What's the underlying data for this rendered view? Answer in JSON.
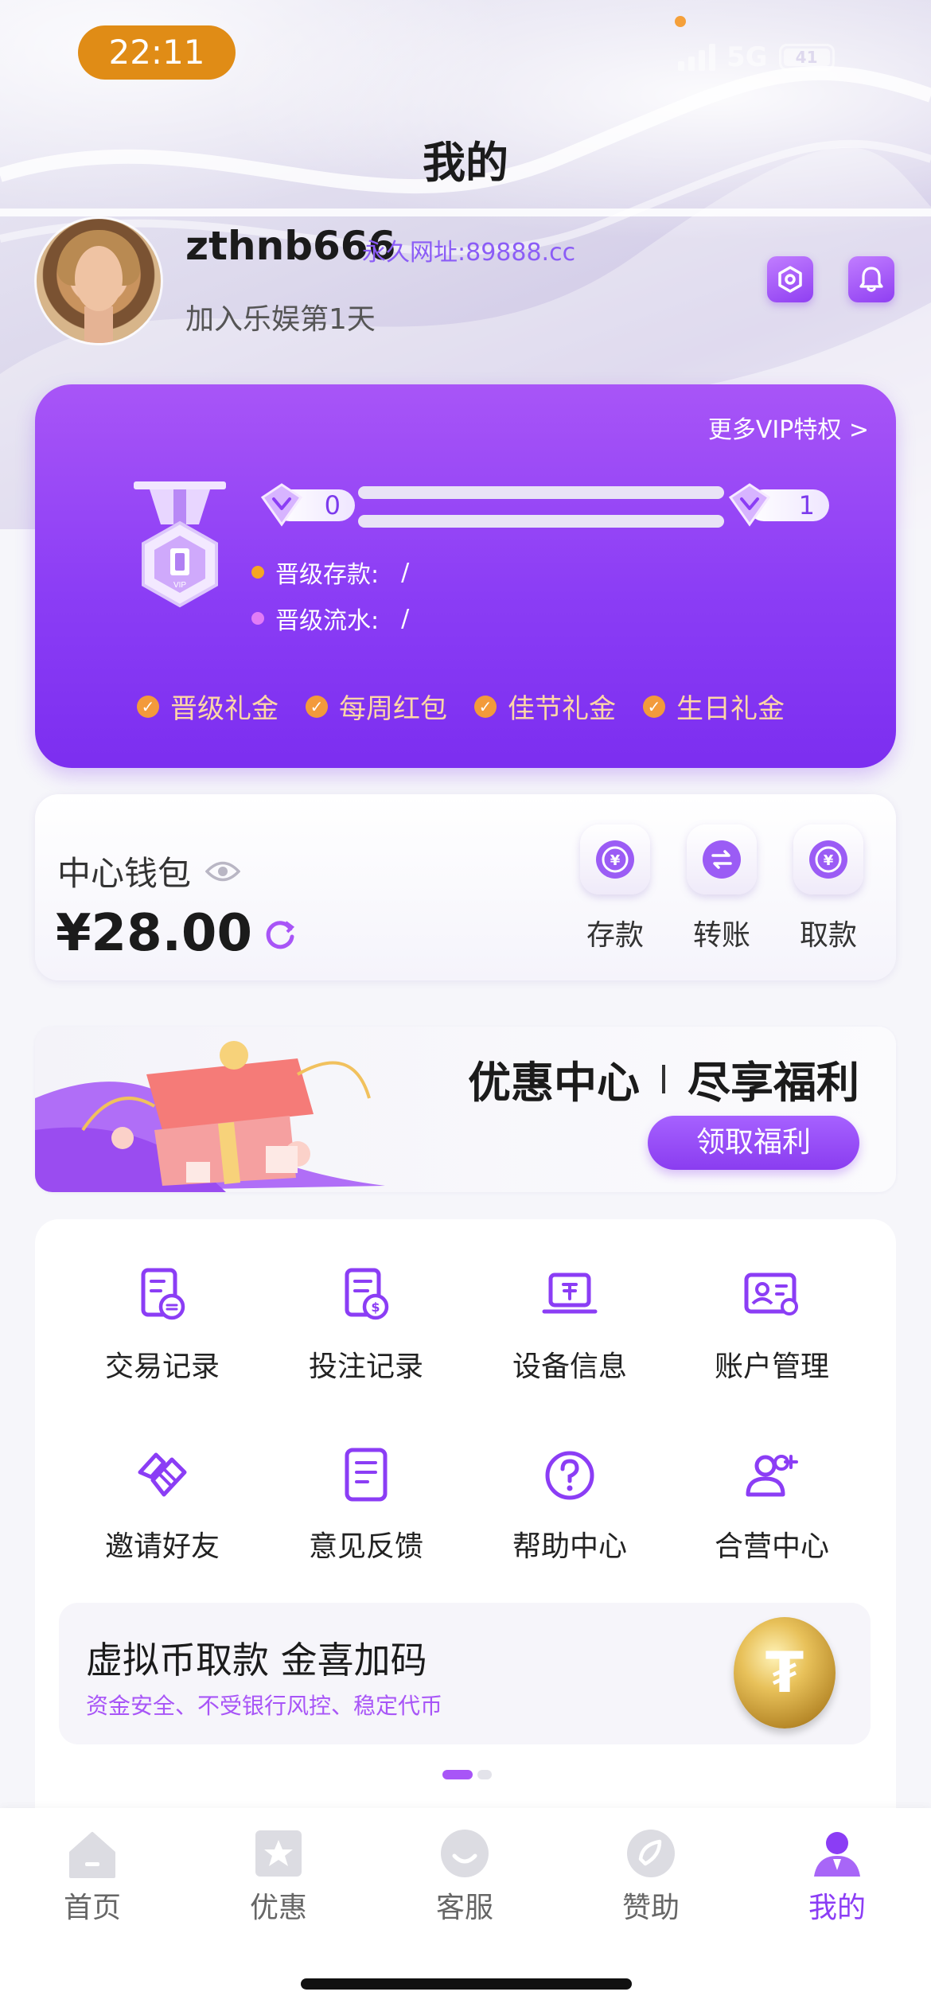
{
  "status_bar": {
    "time": "22:11",
    "network": "5G",
    "battery": "41"
  },
  "header": {
    "title": "我的"
  },
  "profile": {
    "username": "zthnb666",
    "permanent_url": "永久网址:89888.cc",
    "join_text": "加入乐娱第1天",
    "icons": [
      "settings-icon",
      "bell-icon"
    ]
  },
  "vip": {
    "more_link": "更多VIP特权 >",
    "current_level": "0",
    "next_level": "1",
    "upgrade_deposit_label": "晋级存款:",
    "upgrade_deposit_value": "/",
    "upgrade_turnover_label": "晋级流水:",
    "upgrade_turnover_value": "/",
    "perks": [
      "晋级礼金",
      "每周红包",
      "佳节礼金",
      "生日礼金"
    ],
    "colors": {
      "card": "#8b3df5",
      "perk_text": "#ffd7a6",
      "deposit_dot": "#f5a623",
      "turnover_dot": "#e27cf6"
    }
  },
  "wallet": {
    "label": "中心钱包",
    "amount": "¥28.00",
    "actions": [
      {
        "label": "存款",
        "icon": "deposit-icon"
      },
      {
        "label": "转账",
        "icon": "transfer-icon"
      },
      {
        "label": "取款",
        "icon": "withdraw-icon"
      }
    ]
  },
  "promo": {
    "title_left": "优惠中心",
    "title_right": "尽享福利",
    "button": "领取福利"
  },
  "menu": {
    "items": [
      {
        "label": "交易记录",
        "icon": "transaction-record-icon"
      },
      {
        "label": "投注记录",
        "icon": "bet-record-icon"
      },
      {
        "label": "设备信息",
        "icon": "device-info-icon"
      },
      {
        "label": "账户管理",
        "icon": "account-management-icon"
      },
      {
        "label": "邀请好友",
        "icon": "invite-friends-icon"
      },
      {
        "label": "意见反馈",
        "icon": "feedback-icon"
      },
      {
        "label": "帮助中心",
        "icon": "help-center-icon"
      },
      {
        "label": "合营中心",
        "icon": "partner-center-icon"
      }
    ]
  },
  "crypto_banner": {
    "title": "虚拟币取款  金喜加码",
    "subtitle": "资金安全、不受银行风控、稳定代币",
    "coin_icon": "tether-coin-icon"
  },
  "tabbar": {
    "items": [
      {
        "label": "首页",
        "icon": "home-icon",
        "active": false
      },
      {
        "label": "优惠",
        "icon": "promotions-icon",
        "active": false
      },
      {
        "label": "客服",
        "icon": "customer-service-icon",
        "active": false
      },
      {
        "label": "赞助",
        "icon": "sponsor-icon",
        "active": false
      },
      {
        "label": "我的",
        "icon": "profile-icon",
        "active": true
      }
    ],
    "active_color": "#8b3df5"
  }
}
